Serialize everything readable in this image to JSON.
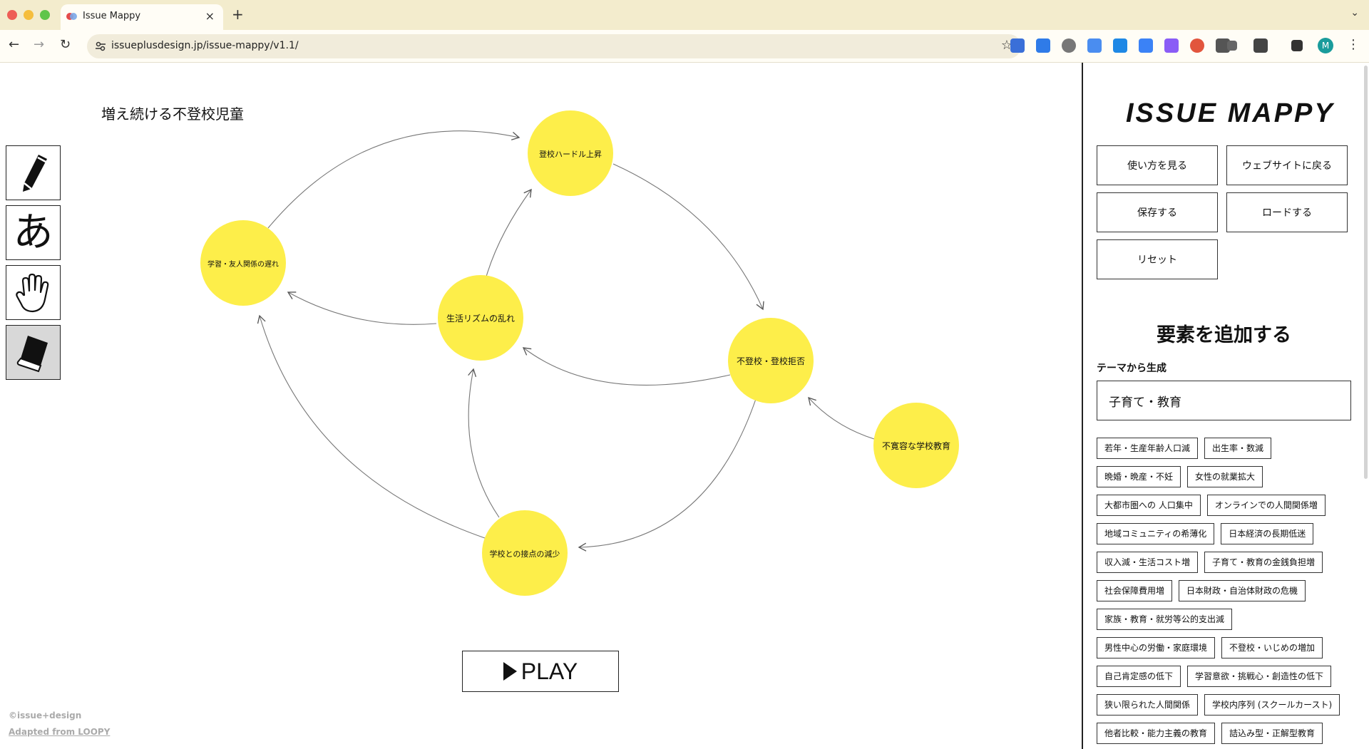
{
  "browser": {
    "tab_title": "Issue Mappy",
    "tab_close": "×",
    "new_tab": "+",
    "url": "issueplusdesign.jp/issue-mappy/v1.1/",
    "avatar_initial": "M"
  },
  "canvas": {
    "title": "増え続ける不登校児童",
    "tools": [
      {
        "name": "pencil",
        "icon": "pencil-icon"
      },
      {
        "name": "text",
        "icon": "text-icon",
        "label": "あ"
      },
      {
        "name": "hand",
        "icon": "hand-icon"
      },
      {
        "name": "eraser",
        "icon": "eraser-icon",
        "active": true
      }
    ],
    "nodes": [
      {
        "id": "hurdle",
        "label": "登校ハードル上昇"
      },
      {
        "id": "study",
        "label": "学習・友人関係の遅れ"
      },
      {
        "id": "rhythm",
        "label": "生活リズムの乱れ"
      },
      {
        "id": "refusal",
        "label": "不登校・登校拒否"
      },
      {
        "id": "intolerant",
        "label": "不寛容な学校教育"
      },
      {
        "id": "contact",
        "label": "学校との接点の減少"
      }
    ],
    "node_color": "#fdee4a",
    "play_label": "PLAY",
    "credit": "©issue+design",
    "credit_link": "Adapted from LOOPY"
  },
  "panel": {
    "brand": "ISSUE MAPPY",
    "buttons": {
      "howto": "使い方を見る",
      "website": "ウェブサイトに戻る",
      "save": "保存する",
      "load": "ロードする",
      "reset": "リセット"
    },
    "add_section_title": "要素を追加する",
    "theme_label": "テーマから生成",
    "theme_value": "子育て・教育",
    "tags": [
      "若年・生産年齢人口減",
      "出生率・数減",
      "晩婚・晩産・不妊",
      "女性の就業拡大",
      "大都市圏への 人口集中",
      "オンラインでの人間関係増",
      "地域コミュニティの希薄化",
      "日本経済の長期低迷",
      "収入減・生活コスト増",
      "子育て・教育の金銭負担増",
      "社会保障費用増",
      "日本財政・自治体財政の危機",
      "家族・教育・就労等公的支出減",
      "男性中心の労働・家庭環境",
      "不登校・いじめの増加",
      "自己肯定感の低下",
      "学習意欲・挑戦心・創造性の低下",
      "狭い限られた人間関係",
      "学校内序列 (スクールカースト)",
      "他者比較・能力主義の教育",
      "詰込み型・正解型教育"
    ]
  }
}
